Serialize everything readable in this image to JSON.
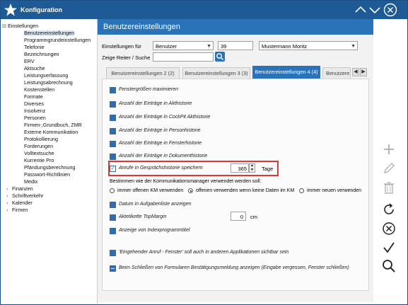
{
  "window": {
    "title": "Konfiguration",
    "accent": "#1e5a96",
    "highlight_color": "#d9373a"
  },
  "tree": {
    "items": [
      {
        "label": "Einstellungen",
        "expander": "⊟"
      },
      {
        "label": "Benutzereinstellungen"
      },
      {
        "label": "Programmgrundeinstellungen"
      },
      {
        "label": "Telefonie"
      },
      {
        "label": "Bezeichnungen"
      },
      {
        "label": "ERV"
      },
      {
        "label": "Aktsuche"
      },
      {
        "label": "Leistungserfassung"
      },
      {
        "label": "Leistungsabrechnung"
      },
      {
        "label": "Kostenstellen"
      },
      {
        "label": "Formate"
      },
      {
        "label": "Diverses"
      },
      {
        "label": "Insolvenz"
      },
      {
        "label": "Personen"
      },
      {
        "label": "Firmen-,Grundbuch, ZMR"
      },
      {
        "label": "Externe Kommunikation"
      },
      {
        "label": "Protokollierung"
      },
      {
        "label": "Forderungen"
      },
      {
        "label": "Volltextsuche"
      },
      {
        "label": "Kurrentie Pro"
      },
      {
        "label": "Pfändungsberechnung"
      },
      {
        "label": "Passwort-Richtlinien"
      },
      {
        "label": "Medix"
      },
      {
        "label": "Finanzen",
        "expander": "›"
      },
      {
        "label": "Schriftverkehr",
        "expander": "›"
      },
      {
        "label": "Kalender",
        "expander": "›"
      },
      {
        "label": "Firmen",
        "expander": "›"
      }
    ]
  },
  "main": {
    "title": "Benutzereinstellungen",
    "settings_for_label": "Einstellungen für",
    "settings_for_value": "Benutzer",
    "user_id": "39",
    "user_name": "Mustermann Moritz",
    "tab_search_label": "Zeige Reiter / Suche",
    "tab_search_value": "",
    "tabs": [
      {
        "label": "Benutzereinstellungen 2 (2)"
      },
      {
        "label": "Benutzereinstellungen 3 (3)"
      },
      {
        "label": "Benutzereinstellungen 4 (4)"
      },
      {
        "label": "Benutzere"
      }
    ],
    "options": [
      {
        "label": "Fenstergrößen maximieren"
      },
      {
        "label": "Anzahl der Einträge in Akthistorie"
      },
      {
        "label": "Anzahl der Einträge in CockPit Akthistorie"
      },
      {
        "label": "Anzahl der Einträge in Personhistorie"
      },
      {
        "label": "Anzahl der Einträge in Fensterhistorie"
      },
      {
        "label": "Anzahl der Einträge in Dokumenthistorie"
      }
    ],
    "call_history": {
      "label": "Anrufe in Gesprächshistorie speichern",
      "value": "365",
      "unit": "Tage"
    },
    "km_question": "Bestimmen wie der Kommunikationsmanager verwendet werden soll:",
    "radio_options": [
      {
        "label": "immer offenen KM verwenden"
      },
      {
        "label": "offenen verwenden wenn keine Daten im KM"
      },
      {
        "label": "immer neuen verwenden"
      }
    ],
    "lower_options": [
      {
        "label": "Datum in Aufgabenliste anzeigen"
      },
      {
        "label": "Aktetikette TopMargin"
      },
      {
        "label": "Anzeige von Indexprogrammtitel"
      }
    ],
    "top_margin": {
      "value": "0",
      "unit": "cm"
    },
    "bottom_options": [
      {
        "label": "'Eingehender Anruf - Fenster' soll auch in anderen Applikationen sichtbar sein"
      },
      {
        "label": "Beim Schließen von Formularen Bestätigungsmeldung anzeigen (Eingabe vergessen, Fenster schließen)"
      }
    ]
  },
  "side_icons": [
    "plus-icon",
    "pencil-icon",
    "trash-icon",
    "refresh-icon",
    "cancel-icon",
    "checkmark-icon",
    "search-icon"
  ]
}
